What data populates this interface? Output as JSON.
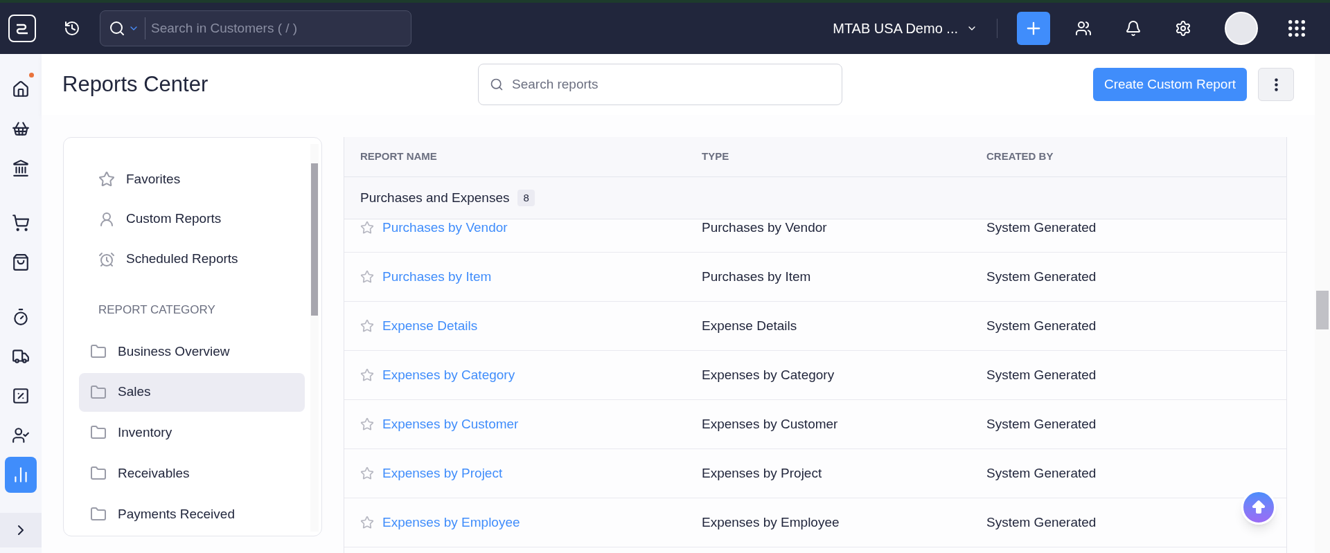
{
  "topbar": {
    "search_placeholder": "Search in Customers ( / )",
    "organization": "MTAB USA Demo ..."
  },
  "rail": [
    {
      "selected": false,
      "dot": true
    },
    {
      "selected": false,
      "dot": false
    },
    {
      "selected": false,
      "dot": false
    },
    {
      "selected": false,
      "dot": false
    },
    {
      "selected": false,
      "dot": false
    },
    {
      "selected": false,
      "dot": false
    },
    {
      "selected": false,
      "dot": false
    },
    {
      "selected": false,
      "dot": false
    },
    {
      "selected": false,
      "dot": false
    },
    {
      "selected": true,
      "dot": false
    }
  ],
  "header": {
    "title": "Reports Center",
    "search_placeholder": "Search reports",
    "create_button": "Create Custom Report"
  },
  "panel": {
    "links": [
      {
        "label": "Favorites"
      },
      {
        "label": "Custom Reports"
      },
      {
        "label": "Scheduled Reports"
      }
    ],
    "category_heading": "REPORT CATEGORY",
    "categories": [
      {
        "label": "Business Overview",
        "selected": false
      },
      {
        "label": "Sales",
        "selected": true
      },
      {
        "label": "Inventory",
        "selected": false
      },
      {
        "label": "Receivables",
        "selected": false
      },
      {
        "label": "Payments Received",
        "selected": false
      }
    ]
  },
  "table": {
    "columns": [
      "REPORT NAME",
      "TYPE",
      "CREATED BY"
    ],
    "group": {
      "name": "Purchases and Expenses",
      "count": "8"
    },
    "rows": [
      {
        "name": "Purchases by Vendor",
        "type": "Purchases by Vendor",
        "created_by": "System Generated",
        "favorite": false
      },
      {
        "name": "Purchases by Item",
        "type": "Purchases by Item",
        "created_by": "System Generated",
        "favorite": false
      },
      {
        "name": "Expense Details",
        "type": "Expense Details",
        "created_by": "System Generated",
        "favorite": false
      },
      {
        "name": "Expenses by Category",
        "type": "Expenses by Category",
        "created_by": "System Generated",
        "favorite": false
      },
      {
        "name": "Expenses by Customer",
        "type": "Expenses by Customer",
        "created_by": "System Generated",
        "favorite": false
      },
      {
        "name": "Expenses by Project",
        "type": "Expenses by Project",
        "created_by": "System Generated",
        "favorite": false
      },
      {
        "name": "Expenses by Employee",
        "type": "Expenses by Employee",
        "created_by": "System Generated",
        "favorite": false
      }
    ]
  }
}
